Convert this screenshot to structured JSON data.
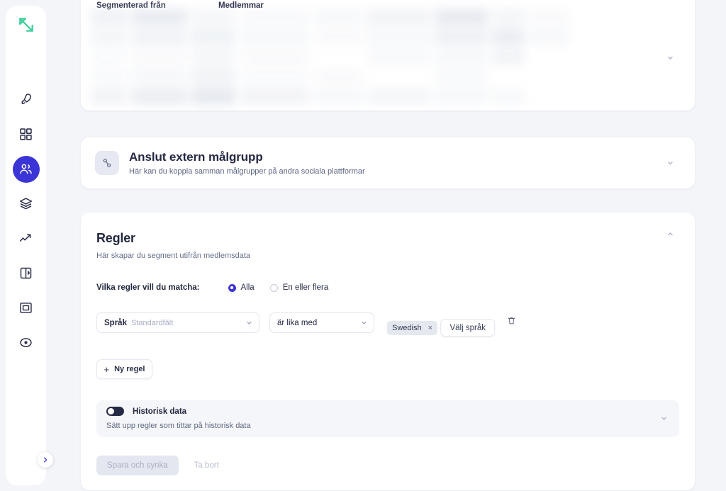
{
  "app": {
    "logo_name": "app-logo",
    "accent_color": "#3b34d6",
    "logo_color": "#3ecf9a",
    "background_color": "#f3f5f9"
  },
  "sidebar": {
    "expand_button_label": "›",
    "items": [
      {
        "icon": "rocket-icon",
        "name": "campaigns",
        "active": false
      },
      {
        "icon": "grid-icon",
        "name": "dashboard",
        "active": false
      },
      {
        "icon": "users-icon",
        "name": "audiences",
        "active": true
      },
      {
        "icon": "layers-icon",
        "name": "layers",
        "active": false
      },
      {
        "icon": "trending-up-icon",
        "name": "analytics",
        "active": false
      },
      {
        "icon": "book-icon",
        "name": "content",
        "active": false
      },
      {
        "icon": "frame-icon",
        "name": "templates",
        "active": false
      },
      {
        "icon": "target-icon",
        "name": "targeting",
        "active": false
      }
    ]
  },
  "table_card": {
    "columns": [
      "Segmenterad från",
      "Medlemmar"
    ],
    "chevron_icon": "chevron-down-icon"
  },
  "connect_card": {
    "icon": "connect-icon",
    "title": "Anslut extern målgrupp",
    "subtitle": "Här kan du koppla samman målgrupper på andra sociala plattformar",
    "chevron_icon": "chevron-down-icon"
  },
  "rules_card": {
    "title": "Regler",
    "subtitle": "Här skapar du segment utifrån medlemsdata",
    "chevron_icon": "chevron-up-icon",
    "match": {
      "label": "Vilka regler vill du matcha:",
      "options": [
        {
          "label": "Alla",
          "selected": true
        },
        {
          "label": "En eller flera",
          "selected": false
        }
      ]
    },
    "rule": {
      "field_value": "Språk",
      "field_placeholder": "Standardfält",
      "operator_value": "är lika med",
      "chip_label": "Swedish",
      "chip_remove": "×",
      "picker_label": "Välj språk",
      "delete_icon": "trash-icon"
    },
    "new_rule_button": {
      "plus": "+",
      "label": "Ny regel"
    },
    "historical": {
      "toggle_state": "off",
      "title": "Historisk data",
      "subtitle": "Sätt upp regler som tittar på historisk data",
      "chevron_icon": "chevron-down-icon"
    },
    "actions": {
      "save_label": "Spara och synka",
      "save_disabled": true,
      "delete_label": "Ta bort"
    }
  }
}
